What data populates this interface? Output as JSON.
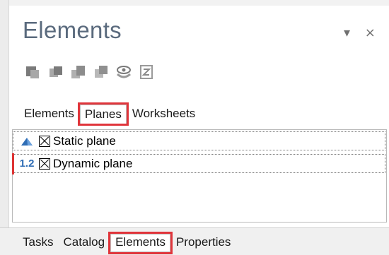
{
  "panel": {
    "title": "Elements"
  },
  "window_buttons": {
    "dropdown_icon": "triangle-down-icon",
    "close_label": "×"
  },
  "toolbar": {
    "buttons": [
      {
        "icon": "layer-solid-icon"
      },
      {
        "icon": "layer-back-icon"
      },
      {
        "icon": "layer-forward-icon"
      },
      {
        "icon": "layer-front-icon"
      },
      {
        "icon": "visibility-eye-icon"
      },
      {
        "icon": "edit-z-icon"
      }
    ]
  },
  "top_tabs": [
    {
      "label": "Elements"
    },
    {
      "label": "Planes",
      "active": true
    },
    {
      "label": "Worksheets"
    }
  ],
  "planes": [
    {
      "label": "Static plane",
      "icon": "static-plane-icon",
      "checked": false
    },
    {
      "label": "Dynamic plane",
      "icon": "dynamic-plane-icon",
      "icon_text": "1.2",
      "checked": false
    }
  ],
  "bottom_tabs": [
    {
      "label": "Tasks"
    },
    {
      "label": "Catalog"
    },
    {
      "label": "Elements",
      "active": true
    },
    {
      "label": "Properties"
    }
  ],
  "colors": {
    "title": "#5a6a7d",
    "highlight": "#e0353b",
    "accent": "#2f6db5"
  }
}
